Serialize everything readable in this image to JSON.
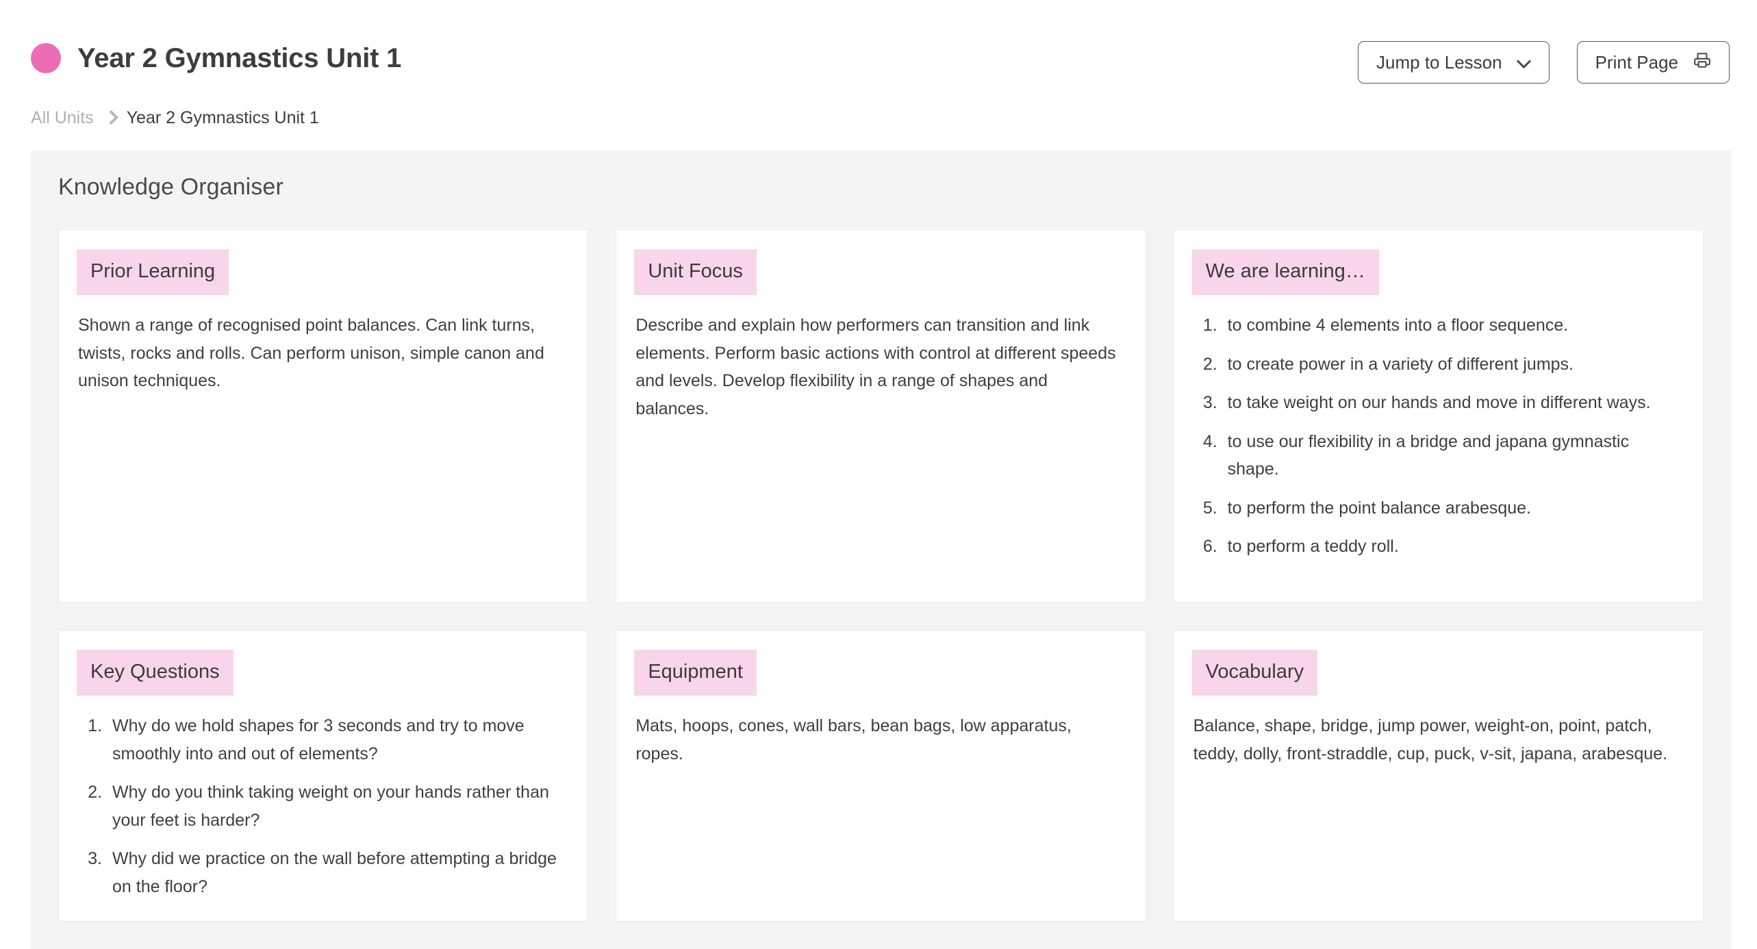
{
  "header": {
    "unit_dot_color": "#ec6db4",
    "title": "Year 2 Gymnastics Unit 1",
    "breadcrumb": {
      "root": "All Units",
      "current": "Year 2 Gymnastics Unit 1"
    },
    "actions": {
      "jump_to_lesson": "Jump to Lesson",
      "print_page": "Print Page"
    }
  },
  "knowledge_organiser": {
    "heading": "Knowledge Organiser",
    "badge_color": "#f9d5ec",
    "cards": [
      {
        "title": "Prior Learning",
        "type": "paragraph",
        "text": "Shown a range of recognised point balances. Can link turns, twists, rocks and rolls. Can perform unison, simple canon and unison techniques."
      },
      {
        "title": "Unit Focus",
        "type": "paragraph",
        "text": "Describe and explain how performers can transition and link elements. Perform basic actions with control at different speeds and levels. Develop flexibility in a range of shapes and balances."
      },
      {
        "title": "We are learning…",
        "type": "list",
        "items": [
          "to combine 4 elements into a floor sequence.",
          "to create power in a variety of different jumps.",
          "to take weight on our hands and move in different ways.",
          "to use our flexibility in a bridge and japana gymnastic shape.",
          "to perform the point balance arabesque.",
          "to perform a teddy roll."
        ]
      },
      {
        "title": "Key Questions",
        "type": "list",
        "items": [
          "Why do we hold shapes for 3 seconds and try to move smoothly into and out of elements?",
          "Why do you think taking weight on your hands rather than your feet is harder?",
          "Why did we practice on the wall before attempting a bridge on the floor?"
        ]
      },
      {
        "title": "Equipment",
        "type": "paragraph",
        "text": "Mats, hoops, cones, wall bars, bean bags, low apparatus, ropes."
      },
      {
        "title": "Vocabulary",
        "type": "paragraph",
        "text": "Balance, shape, bridge, jump power, weight-on, point, patch, teddy, dolly, front-straddle, cup, puck, v-sit, japana, arabesque."
      }
    ]
  }
}
